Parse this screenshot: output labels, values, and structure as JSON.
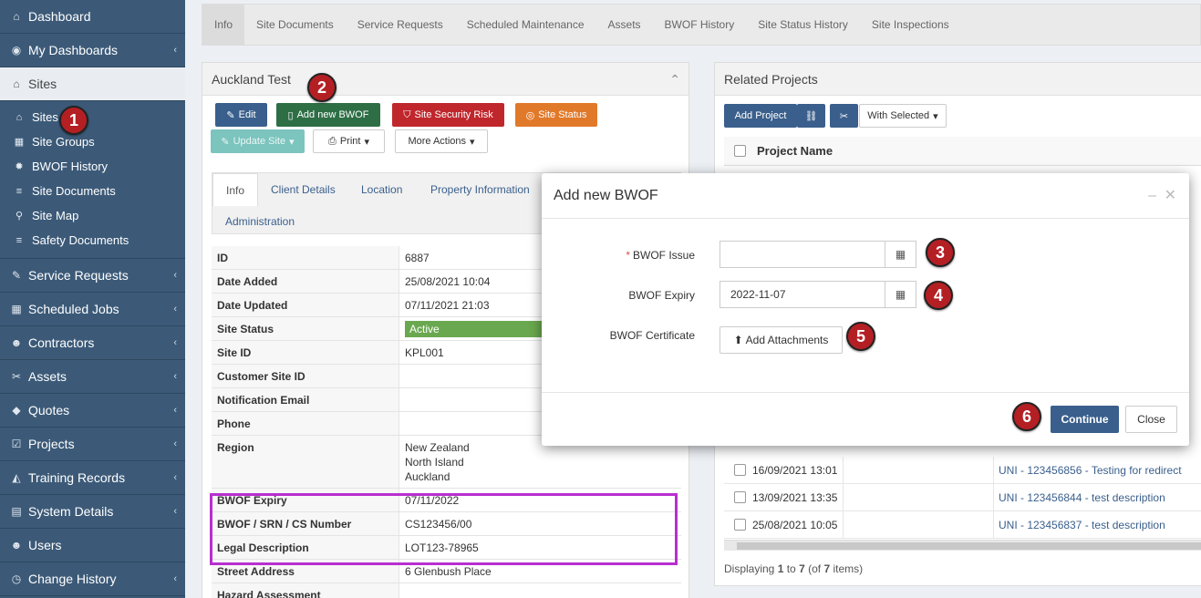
{
  "sidebar": {
    "items": [
      {
        "label": "Dashboard",
        "icon": "dashboard-icon",
        "glyph": "🏠",
        "chev": false
      },
      {
        "label": "My Dashboards",
        "icon": "dashboard-gauge-icon",
        "glyph": "◉",
        "chev": true
      },
      {
        "label": "Sites",
        "icon": "home-icon",
        "glyph": "⌂",
        "chev": false
      }
    ],
    "sub_items": [
      {
        "label": "Sites",
        "icon": "home-icon",
        "glyph": "⌂"
      },
      {
        "label": "Site Groups",
        "icon": "building-icon",
        "glyph": "▦"
      },
      {
        "label": "BWOF History",
        "icon": "gear-icon",
        "glyph": "✹"
      },
      {
        "label": "Site Documents",
        "icon": "list-icon",
        "glyph": "≡"
      },
      {
        "label": "Site Map",
        "icon": "map-marker-icon",
        "glyph": "⚲"
      },
      {
        "label": "Safety Documents",
        "icon": "list-icon",
        "glyph": "≡"
      }
    ],
    "items_after": [
      {
        "label": "Service Requests",
        "icon": "wrench-icon",
        "glyph": "✎"
      },
      {
        "label": "Scheduled Jobs",
        "icon": "calendar-icon",
        "glyph": "▦"
      },
      {
        "label": "Contractors",
        "icon": "users-icon",
        "glyph": "☻"
      },
      {
        "label": "Assets",
        "icon": "tools-icon",
        "glyph": "✂"
      },
      {
        "label": "Quotes",
        "icon": "tag-icon",
        "glyph": "◆"
      },
      {
        "label": "Projects",
        "icon": "check-square-icon",
        "glyph": "☑"
      },
      {
        "label": "Training Records",
        "icon": "graduation-cap-icon",
        "glyph": "◭"
      },
      {
        "label": "System Details",
        "icon": "list-alt-icon",
        "glyph": "▤"
      },
      {
        "label": "Users",
        "icon": "users-icon",
        "glyph": "☻"
      },
      {
        "label": "Change History",
        "icon": "clock-icon",
        "glyph": "◷"
      }
    ]
  },
  "top_tabs": [
    "Info",
    "Site Documents",
    "Service Requests",
    "Scheduled Maintenance",
    "Assets",
    "BWOF History",
    "Site Status History",
    "Site Inspections"
  ],
  "site_panel": {
    "title": "Auckland Test",
    "buttons": {
      "edit": "Edit",
      "add_bwof": "Add new BWOF",
      "security_risk": "Site Security Risk",
      "site_status": "Site Status",
      "update_site": "Update Site",
      "print": "Print",
      "more_actions": "More Actions"
    },
    "tabs": [
      "Info",
      "Client Details",
      "Location",
      "Property Information",
      "Administration"
    ],
    "rows": [
      {
        "k": "ID",
        "v": "6887"
      },
      {
        "k": "Date Added",
        "v": "25/08/2021 10:04"
      },
      {
        "k": "Date Updated",
        "v": "07/11/2021 21:03"
      },
      {
        "k": "Site Status",
        "v": "Active"
      },
      {
        "k": "Site ID",
        "v": "KPL001"
      },
      {
        "k": "Customer Site ID",
        "v": ""
      },
      {
        "k": "Notification Email",
        "v": ""
      },
      {
        "k": "Phone",
        "v": ""
      },
      {
        "k": "Region",
        "v1": "New Zealand",
        "v2": "North Island",
        "v3": "Auckland"
      },
      {
        "k": "BWOF Expiry",
        "v": "07/11/2022"
      },
      {
        "k": "BWOF / SRN / CS Number",
        "v": "CS123456/00"
      },
      {
        "k": "Legal Description",
        "v": "LOT123-78965"
      },
      {
        "k": "Street Address",
        "v": "6 Glenbush Place"
      },
      {
        "k": "Hazard Assessment",
        "v": ""
      }
    ]
  },
  "projects_panel": {
    "title": "Related Projects",
    "add_project": "Add Project",
    "with_selected": "With Selected",
    "col_header": "Project Name",
    "rows": [
      {
        "date": "16/09/2021 13:01",
        "name": "UNI - 123456856 - Testing for redirect"
      },
      {
        "date": "13/09/2021 13:35",
        "name": "UNI - 123456844 - test description"
      },
      {
        "date": "25/08/2021 10:05",
        "name": "UNI - 123456837 - test description"
      }
    ],
    "footer_prefix": "Displaying ",
    "footer_from": "1",
    "footer_mid": " to ",
    "footer_to": "7",
    "footer_suffix": " (of ",
    "footer_total": "7",
    "footer_end": " items)"
  },
  "modal": {
    "title": "Add new BWOF",
    "required_mark": "*",
    "bwof_issue_label": "BWOF Issue",
    "bwof_issue_value": "",
    "bwof_expiry_label": "BWOF Expiry",
    "bwof_expiry_value": "2022-11-07",
    "certificate_label": "BWOF Certificate",
    "attach_label": "Add Attachments",
    "continue_label": "Continue",
    "close_label": "Close"
  },
  "callouts": [
    "1",
    "2",
    "3",
    "4",
    "5",
    "6"
  ],
  "colors": {
    "sidebar_bg": "#3c5a78",
    "primary": "#3a5f8c",
    "green": "#2d6e45",
    "danger": "#c0272d",
    "warning": "#e1792a",
    "highlight": "#b82fcf",
    "callout": "#b41f24"
  }
}
